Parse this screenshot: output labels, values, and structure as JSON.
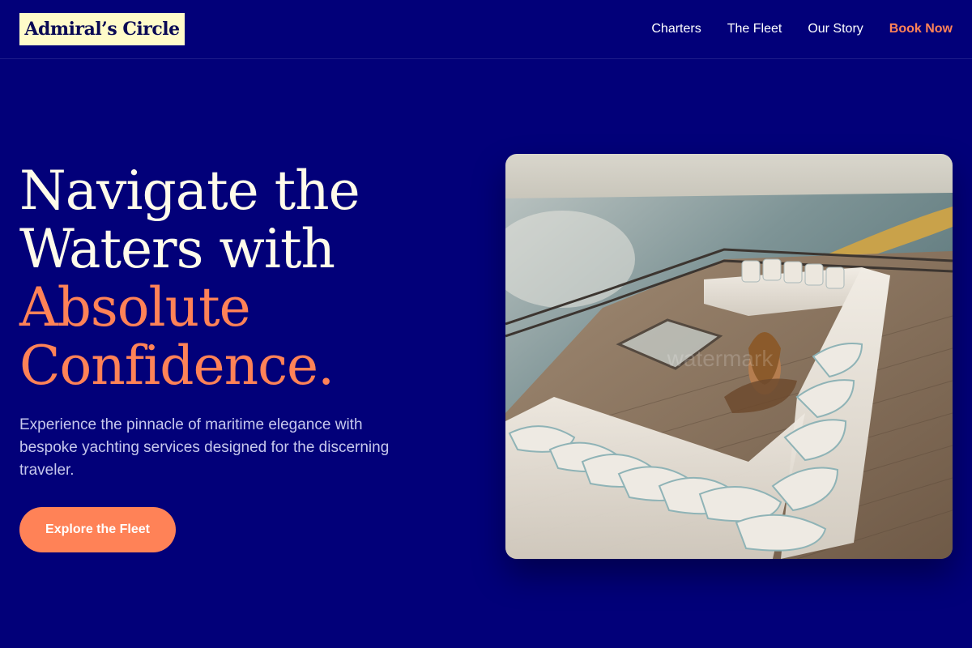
{
  "header": {
    "logo": "Admiral’s Circle",
    "nav": [
      {
        "label": "Charters"
      },
      {
        "label": "The Fleet"
      },
      {
        "label": "Our Story"
      },
      {
        "label": "Book Now"
      }
    ]
  },
  "hero": {
    "headline_line1": "Navigate the",
    "headline_line2": "Waters with",
    "headline_accent_line1": "Absolute",
    "headline_accent_line2": "Confidence.",
    "subtitle": "Experience the pinnacle of maritime elegance with bespoke yachting services designed for the discerning traveler.",
    "cta_label": "Explore the Fleet",
    "image_watermark": "watermark"
  },
  "colors": {
    "background": "#020079",
    "accent": "#ff8257",
    "logo_bg": "#fffbc9"
  }
}
